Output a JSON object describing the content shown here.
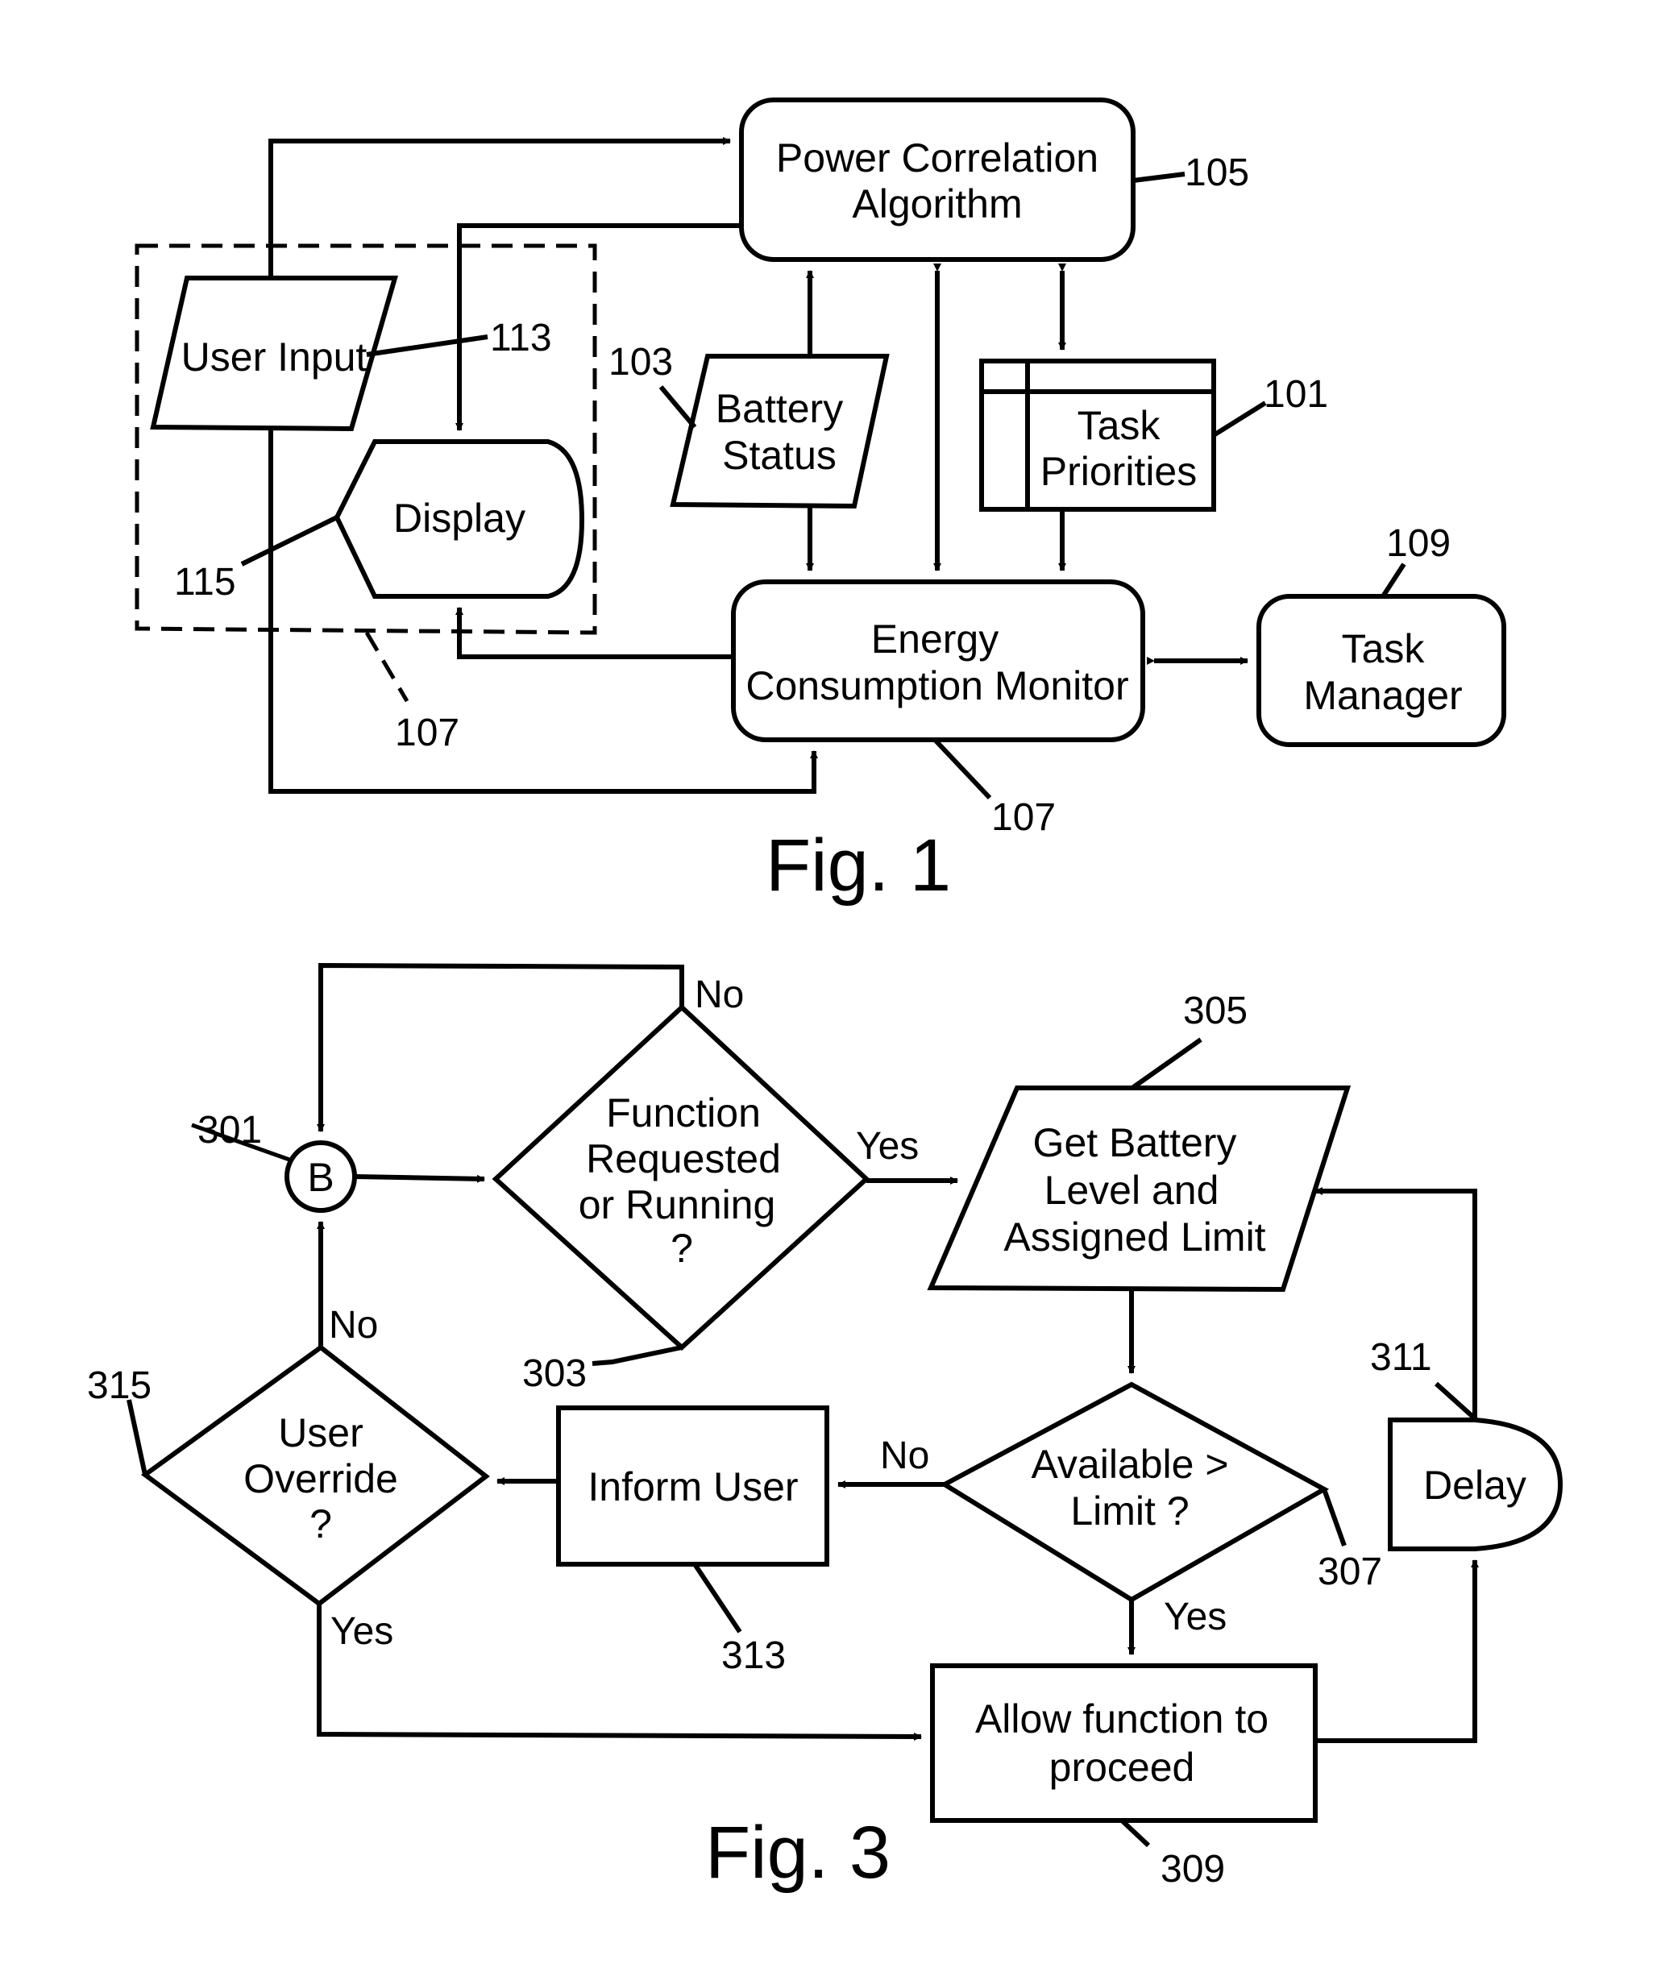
{
  "fig1": {
    "caption": "Fig. 1",
    "nodes": {
      "power_correlation": {
        "lines": [
          "Power Correlation",
          "Algorithm"
        ],
        "ref": "105"
      },
      "user_input": {
        "lines": [
          "User Input"
        ],
        "ref": "113"
      },
      "display": {
        "lines": [
          "Display"
        ],
        "ref": "115"
      },
      "battery_status": {
        "lines": [
          "Battery",
          "Status"
        ],
        "ref": "103"
      },
      "task_priorities": {
        "lines": [
          "Task",
          "Priorities"
        ],
        "ref": "101"
      },
      "energy_monitor": {
        "lines": [
          "Energy",
          "Consumption Monitor"
        ],
        "ref": "107"
      },
      "task_manager": {
        "lines": [
          "Task",
          "Manager"
        ],
        "ref": "109"
      }
    },
    "group_ref": "107"
  },
  "fig3": {
    "caption": "Fig. 3",
    "nodes": {
      "connector_b": {
        "lines": [
          "B"
        ],
        "ref": "301"
      },
      "function_requested": {
        "lines": [
          "Function",
          "Requested",
          "or Running",
          "?"
        ],
        "ref": "303"
      },
      "get_battery": {
        "lines": [
          "Get Battery",
          "Level and",
          "Assigned Limit"
        ],
        "ref": "305"
      },
      "available_limit": {
        "lines": [
          "Available >",
          "Limit ?"
        ],
        "ref": "307"
      },
      "allow_function": {
        "lines": [
          "Allow function to",
          "proceed"
        ],
        "ref": "309"
      },
      "delay": {
        "lines": [
          "Delay"
        ],
        "ref": "311"
      },
      "inform_user": {
        "lines": [
          "Inform User"
        ],
        "ref": "313"
      },
      "user_override": {
        "lines": [
          "User",
          "Override",
          "?"
        ],
        "ref": "315"
      }
    },
    "edge_labels": {
      "func_no": "No",
      "func_yes": "Yes",
      "avail_no": "No",
      "avail_yes": "Yes",
      "override_no": "No",
      "override_yes": "Yes"
    }
  }
}
